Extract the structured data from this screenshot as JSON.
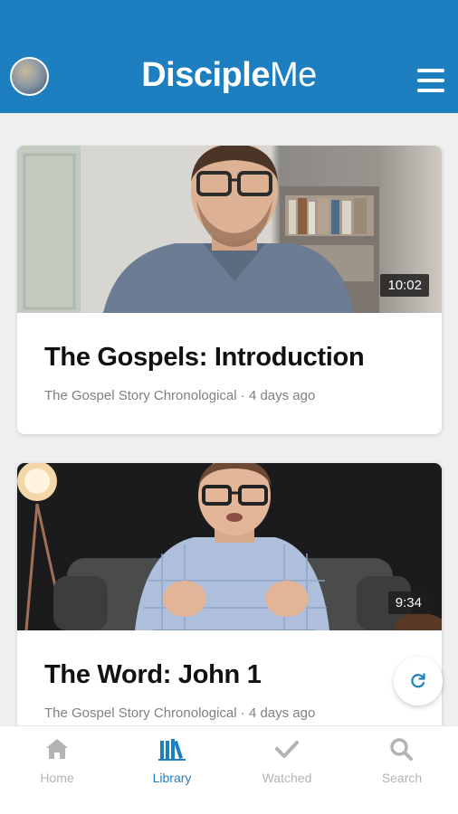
{
  "header": {
    "brand_bold": "Disciple",
    "brand_light": "Me",
    "menu_icon": "hamburger-icon",
    "avatar_icon": "user-avatar"
  },
  "videos": [
    {
      "title": "The Gospels: Introduction",
      "meta": "The Gospel Story Chronological · 4 days ago",
      "duration": "10:02"
    },
    {
      "title": "The Word: John 1",
      "meta": "The Gospel Story Chronological · 4 days ago",
      "duration": "9:34"
    }
  ],
  "refresh_icon": "refresh-icon",
  "nav": {
    "items": [
      {
        "label": "Home",
        "icon": "home-icon",
        "active": false
      },
      {
        "label": "Library",
        "icon": "library-icon",
        "active": true
      },
      {
        "label": "Watched",
        "icon": "checkmark-icon",
        "active": false
      },
      {
        "label": "Search",
        "icon": "search-icon",
        "active": false
      }
    ]
  },
  "colors": {
    "primary": "#1e7fc0",
    "nav_inactive": "#b3b3b3",
    "meta_text": "#808080",
    "background": "#efefef"
  }
}
